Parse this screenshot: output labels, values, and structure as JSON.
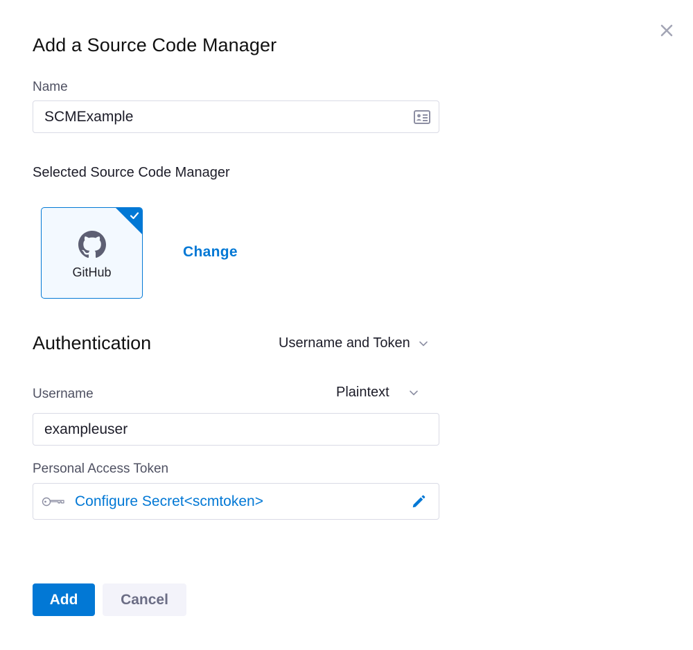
{
  "dialog": {
    "title": "Add a Source Code Manager"
  },
  "name_field": {
    "label": "Name",
    "value": "SCMExample",
    "icon": "id-card-icon"
  },
  "scm": {
    "section_label": "Selected Source Code Manager",
    "selected": "GitHub",
    "change_label": "Change",
    "accent": "#0278d5"
  },
  "authentication": {
    "title": "Authentication",
    "method": "Username and Token"
  },
  "username_field": {
    "label": "Username",
    "type": "Plaintext",
    "value": "exampleuser"
  },
  "token_field": {
    "label": "Personal Access Token",
    "value": "Configure Secret<scmtoken>"
  },
  "actions": {
    "add_label": "Add",
    "cancel_label": "Cancel"
  }
}
